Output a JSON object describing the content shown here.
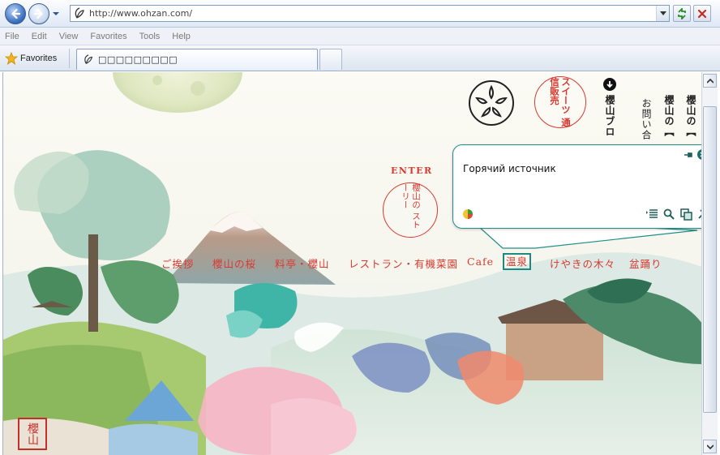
{
  "browser": {
    "address": "http://www.ohzan.com/",
    "menu": [
      "File",
      "Edit",
      "View",
      "Favorites",
      "Tools",
      "Help"
    ],
    "favorites_label": "Favorites",
    "tab_title": "□□□□□□□□□"
  },
  "page": {
    "enter_label": "ENTER",
    "story_stamp": "櫻山の ストーリー",
    "sweets_stamp": "スイーツ 通信販売",
    "top_links": [
      "櫻山ブロ",
      "お問い合",
      "櫻山の【",
      "櫻山の【"
    ],
    "nav": [
      "ご挨拶",
      "櫻山の桜",
      "料亭・櫻山",
      "レストラン・有機菜園",
      "Cafe",
      "温泉",
      "けやきの木々",
      "盆踊り"
    ],
    "selected_nav": "温泉",
    "brand_mark": "櫻山"
  },
  "translator_popup": {
    "text": "Горячий источник"
  },
  "colors": {
    "accent_red": "#d8392f",
    "popup_border": "#1f8f88"
  }
}
